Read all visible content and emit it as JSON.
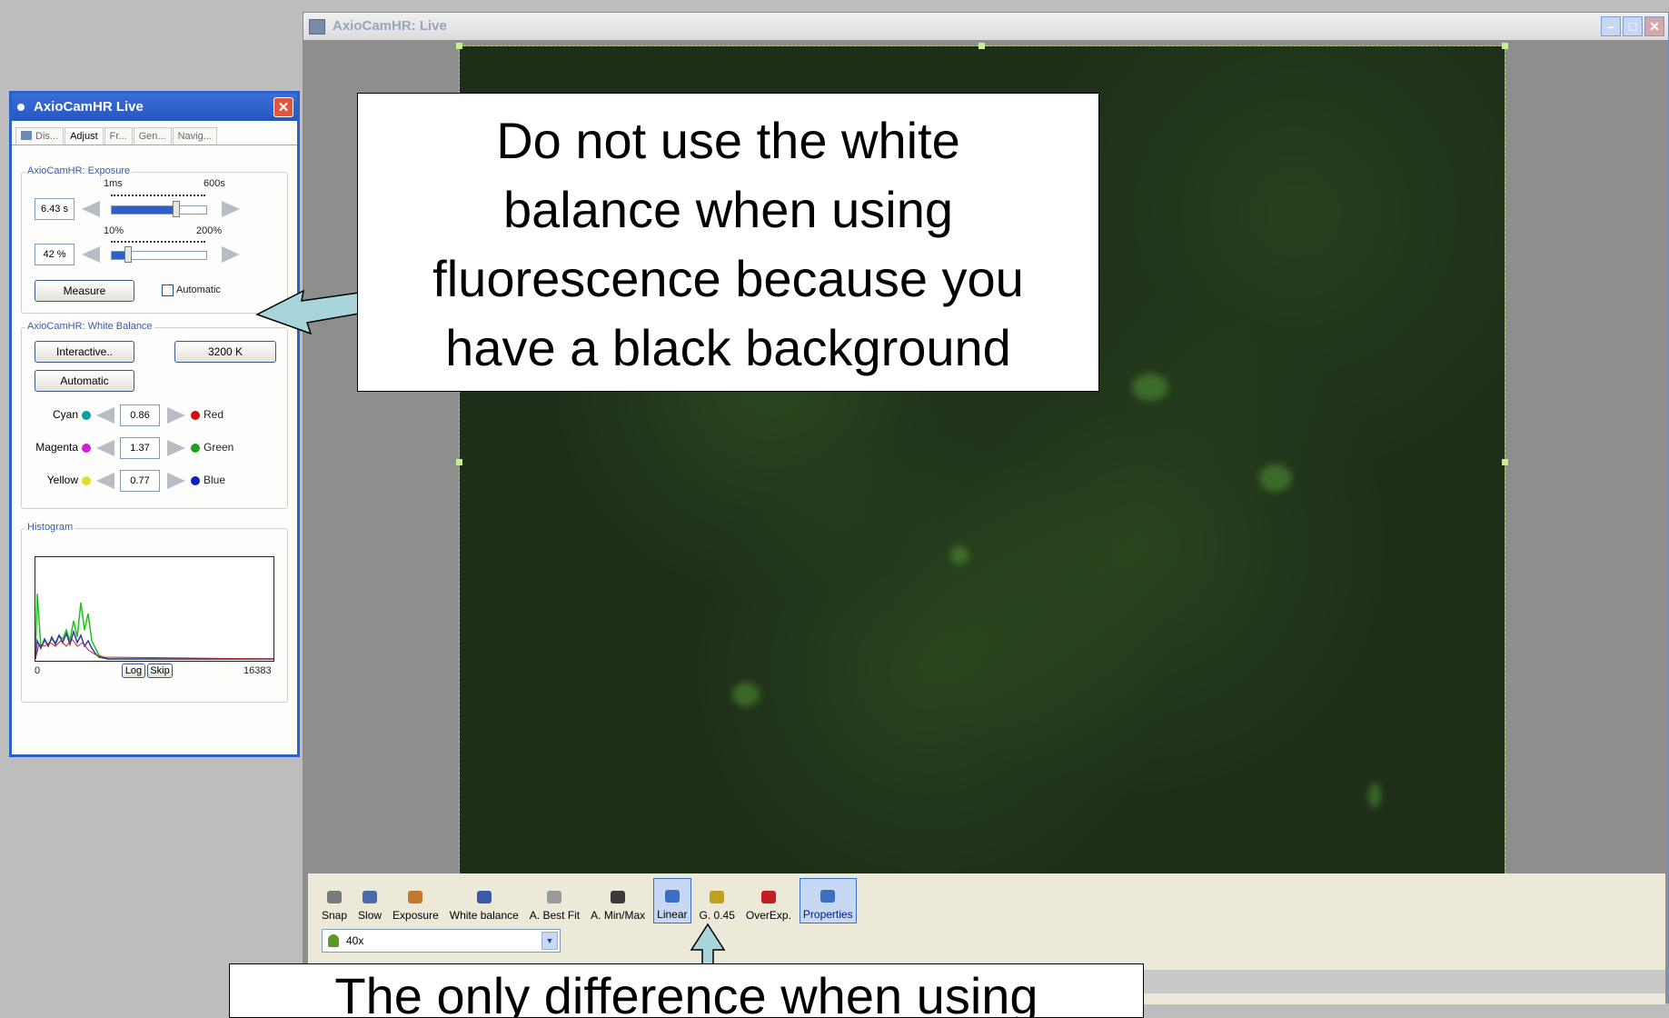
{
  "live_window": {
    "title": "AxioCamHR: Live",
    "buttons": [
      "minimize",
      "maximize",
      "close"
    ]
  },
  "toolbar": {
    "items": [
      {
        "label": "Snap",
        "icon": "camera-icon"
      },
      {
        "label": "Slow",
        "icon": "slow-icon"
      },
      {
        "label": "Exposure",
        "icon": "exposure-icon"
      },
      {
        "label": "White balance",
        "icon": "white-balance-icon"
      },
      {
        "label": "A. Best Fit",
        "icon": "best-fit-icon"
      },
      {
        "label": "A. Min/Max",
        "icon": "min-max-icon"
      },
      {
        "label": "Linear",
        "icon": "linear-icon",
        "active": true
      },
      {
        "label": "G. 0.45",
        "icon": "gamma-icon"
      },
      {
        "label": "OverExp.",
        "icon": "overexposure-icon"
      },
      {
        "label": "Properties",
        "icon": "properties-icon",
        "active": true
      }
    ],
    "objective": "40x",
    "progress": 0.105
  },
  "panel": {
    "title": "AxioCamHR Live",
    "tabs": [
      "Dis...",
      "Adjust",
      "Fr...",
      "Gen...",
      "Navig..."
    ],
    "active_tab": "Adjust",
    "exposure": {
      "group_label": "AxioCamHR: Exposure",
      "time_value": "6.43 s",
      "time_min": "1ms",
      "time_max": "600s",
      "time_level": 0.68,
      "gain_value": "42 %",
      "gain_min": "10%",
      "gain_max": "200%",
      "gain_level": 0.17,
      "measure_label": "Measure",
      "automatic_label": "Automatic"
    },
    "white_balance": {
      "group_label": "AxioCamHR: White Balance",
      "interactive_label": "Interactive..",
      "temperature_label": "3200 K",
      "automatic_label": "Automatic",
      "rows": [
        {
          "left": "Cyan",
          "value": "0.86",
          "right": "Red",
          "left_color": "#00a0a0",
          "right_color": "#d01010"
        },
        {
          "left": "Magenta",
          "value": "1.37",
          "right": "Green",
          "left_color": "#d020d0",
          "right_color": "#20a020"
        },
        {
          "left": "Yellow",
          "value": "0.77",
          "right": "Blue",
          "left_color": "#e0e020",
          "right_color": "#1020c0"
        }
      ]
    },
    "histogram": {
      "group_label": "Histogram",
      "min": "0",
      "max": "16383",
      "log_label": "Log",
      "skip_label": "Skip"
    }
  },
  "callouts": {
    "top": [
      "Do not use the white",
      "balance when using",
      "fluorescence because you",
      "have a black background"
    ],
    "bottom": "The only difference when using"
  },
  "colors": {
    "panel_border": "#2b5fc9",
    "fluorescence_background": "#1f2e19",
    "progress_green": "#00ff00",
    "callout_arrow": "#a8d4dc"
  }
}
